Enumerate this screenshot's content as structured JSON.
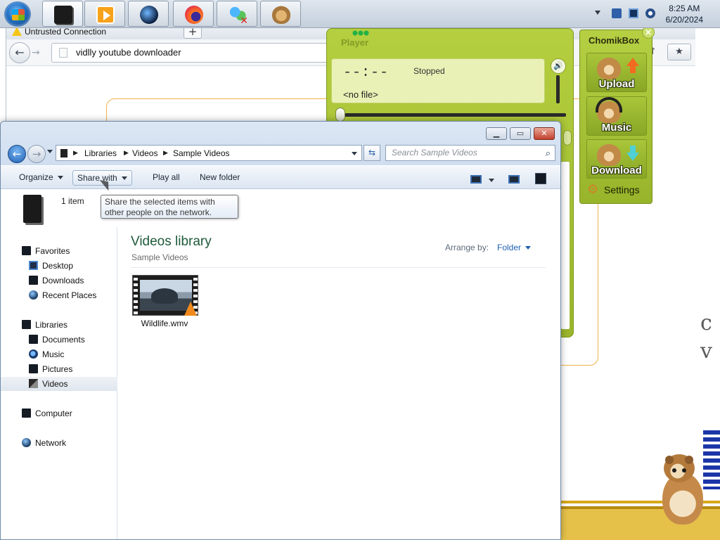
{
  "taskbar": {
    "buttons": [
      {
        "name": "computer"
      },
      {
        "name": "media-center"
      },
      {
        "name": "globe"
      },
      {
        "name": "firefox"
      },
      {
        "name": "users"
      },
      {
        "name": "chomikbox"
      }
    ],
    "clock": {
      "time": "8:25 AM",
      "date": "6/20/2024"
    }
  },
  "browser": {
    "tab_title": "Untrusted Connection",
    "new_tab": "+",
    "url": "vidlly youtube downloader"
  },
  "player": {
    "title": "Player",
    "time": "--:--",
    "status": "Stopped",
    "file": "<no file>"
  },
  "chomikbox": {
    "title": "ChomikBox",
    "buttons": [
      "Upload",
      "Music",
      "Download"
    ],
    "settings": "Settings"
  },
  "explorer": {
    "breadcrumb": [
      "Libraries",
      "Videos",
      "Sample Videos"
    ],
    "search_placeholder": "Search Sample Videos",
    "toolbar": {
      "organize": "Organize",
      "share_with": "Share with",
      "play_all": "Play all",
      "new_folder": "New folder"
    },
    "selection_count": "1 item",
    "tooltip": "Share the selected items with other people on the network.",
    "nav": {
      "favorites": "Favorites",
      "desktop": "Desktop",
      "downloads": "Downloads",
      "recent": "Recent Places",
      "libraries": "Libraries",
      "documents": "Documents",
      "music": "Music",
      "pictures": "Pictures",
      "videos": "Videos",
      "computer": "Computer",
      "network": "Network"
    },
    "library_title": "Videos library",
    "library_subtitle": "Sample Videos",
    "arrange_label": "Arrange by:",
    "arrange_value": "Folder",
    "files": [
      {
        "name": "Wildlife.wmv"
      }
    ]
  },
  "colors": {
    "accent_green": "#9ab52b",
    "library_title": "#1e5b3a",
    "link_blue": "#1f5fb0"
  }
}
